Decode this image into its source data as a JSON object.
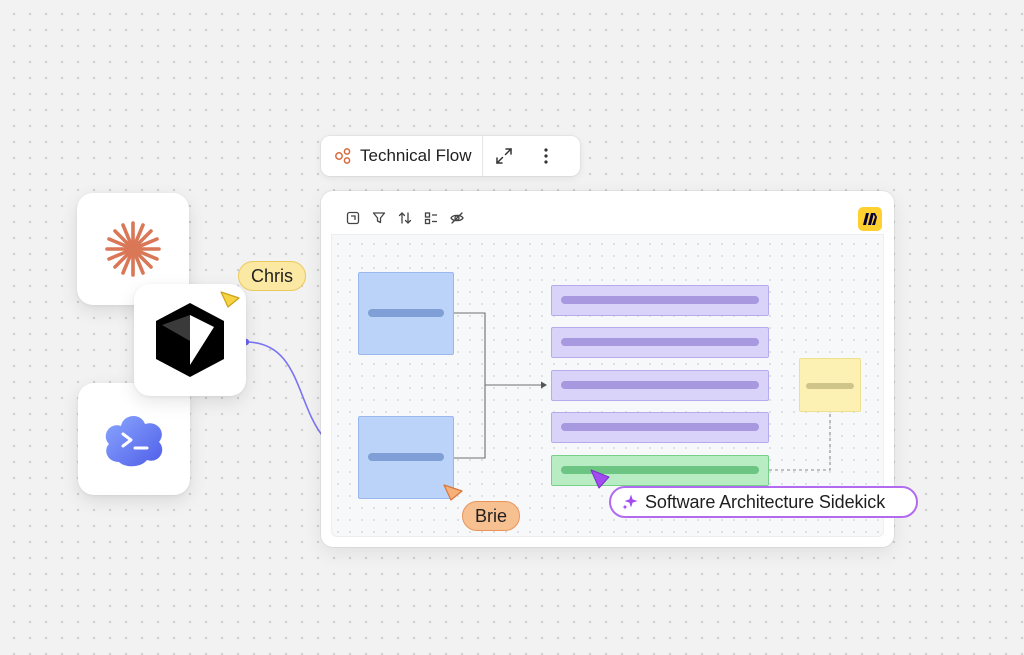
{
  "board": {
    "title": "Technical Flow",
    "title_icon": "flow-icon",
    "expand_icon": "expand-icon",
    "more_icon": "more-vertical-icon",
    "logo_icon": "miro-logo-icon",
    "toolbar_icons": [
      "frame-icon",
      "filter-icon",
      "sort-icon",
      "layout-icon",
      "hide-icon"
    ]
  },
  "apps": [
    {
      "icon": "claude-icon",
      "color": "#d97757"
    },
    {
      "icon": "cursor-icon",
      "color": "#000000"
    },
    {
      "icon": "terminal-cloud-icon",
      "color": "#5b6ef0"
    }
  ],
  "collaborators": [
    {
      "name": "Chris",
      "color": "#f5d342"
    },
    {
      "name": "Brie",
      "color": "#f39d58"
    }
  ],
  "assistant": {
    "label": "Software Architecture Sidekick",
    "icon": "sparkle-icon",
    "color": "#a24cf0"
  }
}
